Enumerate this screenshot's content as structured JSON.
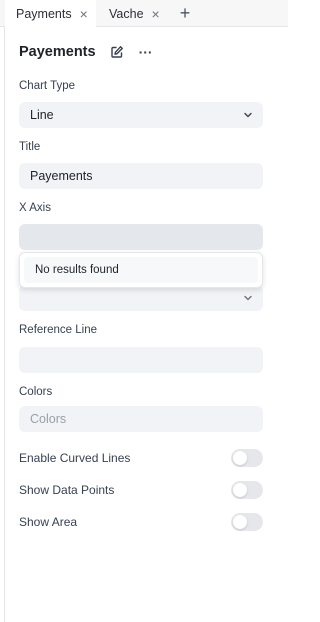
{
  "tabs": [
    {
      "label": "Payments",
      "active": true,
      "close_icon": "close-icon"
    },
    {
      "label": "Vache",
      "active": false,
      "close_icon": "close-icon"
    }
  ],
  "add_tab_icon": "plus-icon",
  "panel": {
    "title": "Payements",
    "edit_icon": "edit-icon",
    "more_icon": "more-horizontal-icon"
  },
  "fields": {
    "chart_type": {
      "label": "Chart Type",
      "value": "Line"
    },
    "title": {
      "label": "Title",
      "value": "Payements"
    },
    "x_axis": {
      "label": "X Axis",
      "value": ""
    },
    "y_axis": {
      "value": ""
    },
    "reference_line": {
      "label": "Reference Line",
      "value": ""
    },
    "colors": {
      "label": "Colors",
      "placeholder": "Colors"
    }
  },
  "dropdown": {
    "message": "No results found"
  },
  "toggles": [
    {
      "label": "Enable Curved Lines",
      "on": false
    },
    {
      "label": "Show Data Points",
      "on": false
    },
    {
      "label": "Show Area",
      "on": false
    }
  ],
  "colors_palette": {
    "accent": "#1f2328",
    "field_bg": "#f1f3f6",
    "toggle_off": "#e5e7eb"
  }
}
